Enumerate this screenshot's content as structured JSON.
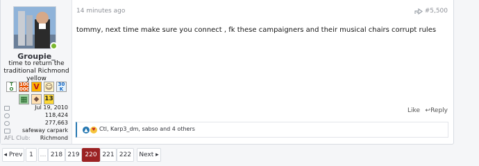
{
  "user": {
    "username": "Groupie_",
    "title": "time to return the traditional Richmond yellow",
    "trophies": [
      {
        "icon": "toty-trophy-icon",
        "text": "T O T Y",
        "bg": "#ffffff",
        "fg": "#2e7d32"
      },
      {
        "icon": "hundred-trophy-icon",
        "text": "100 000",
        "bg": "#e65100",
        "fg": "#ffffff"
      },
      {
        "icon": "v-trophy-icon",
        "text": "V",
        "bg": "#ffb300",
        "fg": "#b71c1c"
      },
      {
        "icon": "face-trophy-icon",
        "text": "☺",
        "bg": "#fff3c4",
        "fg": "#5d4037"
      },
      {
        "icon": "thirtyk-trophy-icon",
        "text": "30 K",
        "bg": "#e3f2fd",
        "fg": "#1565c0"
      },
      {
        "icon": "building-trophy-icon",
        "text": "▦",
        "bg": "#a5d6a7",
        "fg": "#1b5e20"
      },
      {
        "icon": "dog-trophy-icon",
        "text": "◆",
        "bg": "#ffe0b2",
        "fg": "#6d4c41"
      },
      {
        "icon": "thirteen-trophy-icon",
        "text": "13",
        "bg": "#fdd835",
        "fg": "#212121"
      }
    ],
    "stats": [
      {
        "icon": "calendar-icon",
        "key": "",
        "value": "Jul 19, 2010"
      },
      {
        "icon": "messages-icon",
        "key": "",
        "value": "118,424"
      },
      {
        "icon": "reaction-score-icon",
        "key": "",
        "value": "277,663"
      },
      {
        "icon": "location-icon",
        "key": "",
        "value": "safeway carpark"
      },
      {
        "icon": "",
        "key": "AFL Club:",
        "value": "Richmond"
      }
    ]
  },
  "post": {
    "time": "14 minutes ago",
    "number": "#5,500",
    "body": "tommy, next time make sure you connect , fk these campaigners and their musical chairs corrupt rules",
    "like_label": "Like",
    "reply_label": "Reply",
    "reactions_text": "Ctl, Karp3_dm, sabso and 4 others"
  },
  "pagination": {
    "prev": "◂ Prev",
    "next": "Next ▸",
    "pages": [
      "1",
      "…",
      "218",
      "219",
      "220",
      "221",
      "222"
    ],
    "current": "220"
  },
  "colors": {
    "accent": "#2577b1",
    "current_page": "#9b2223",
    "online": "#7ab72f"
  }
}
